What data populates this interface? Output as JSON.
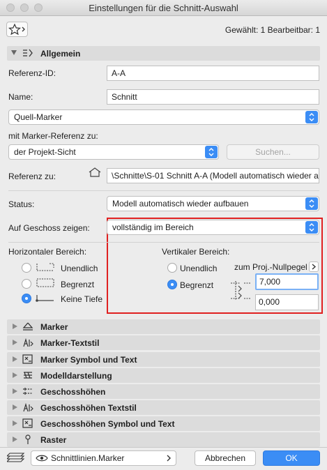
{
  "window": {
    "title": "Einstellungen für die Schnitt-Auswahl"
  },
  "toolbar": {
    "selection_info": "Gewählt: 1 Bearbeitbar: 1"
  },
  "general": {
    "header": "Allgemein",
    "ref_id_label": "Referenz-ID:",
    "ref_id_value": "A-A",
    "name_label": "Name:",
    "name_value": "Schnitt",
    "source_marker": "Quell-Marker",
    "marker_ref_label": "mit Marker-Referenz zu:",
    "marker_ref_value": "der Projekt-Sicht",
    "search_button": "Suchen...",
    "ref_to_label": "Referenz zu:",
    "ref_to_value": "\\Schnitte\\S-01 Schnitt A-A (Modell automatisch wieder a",
    "status_label": "Status:",
    "status_value": "Modell automatisch wieder aufbauen",
    "show_on_story_label": "Auf Geschoss zeigen:",
    "show_on_story_value": "vollständig im Bereich",
    "horizontal_label": "Horizontaler Bereich:",
    "horizontal_options": [
      "Unendlich",
      "Begrenzt",
      "Keine Tiefe"
    ],
    "horizontal_selected": "Keine Tiefe",
    "vertical_label": "Vertikaler Bereich:",
    "vertical_options": [
      "Unendlich",
      "Begrenzt"
    ],
    "vertical_selected": "Begrenzt",
    "zero_level_label": "zum Proj.-Nullpegel",
    "top_value": "7,000",
    "bottom_value": "0,000"
  },
  "sections": [
    {
      "label": "Marker",
      "icon": "marker-icon"
    },
    {
      "label": "Marker-Textstil",
      "icon": "text-style-icon"
    },
    {
      "label": "Marker Symbol und Text",
      "icon": "symbol-text-icon"
    },
    {
      "label": "Modelldarstellung",
      "icon": "model-display-icon"
    },
    {
      "label": "Geschosshöhen",
      "icon": "story-levels-icon"
    },
    {
      "label": "Geschosshöhen Textstil",
      "icon": "text-style-icon"
    },
    {
      "label": "Geschosshöhen Symbol und Text",
      "icon": "symbol-text-icon"
    },
    {
      "label": "Raster",
      "icon": "grid-icon"
    }
  ],
  "footer": {
    "layer_value": "Schnittlinien.Marker",
    "cancel": "Abbrechen",
    "ok": "OK"
  },
  "colors": {
    "accent": "#3b8df5",
    "highlight_box": "#e02020"
  }
}
